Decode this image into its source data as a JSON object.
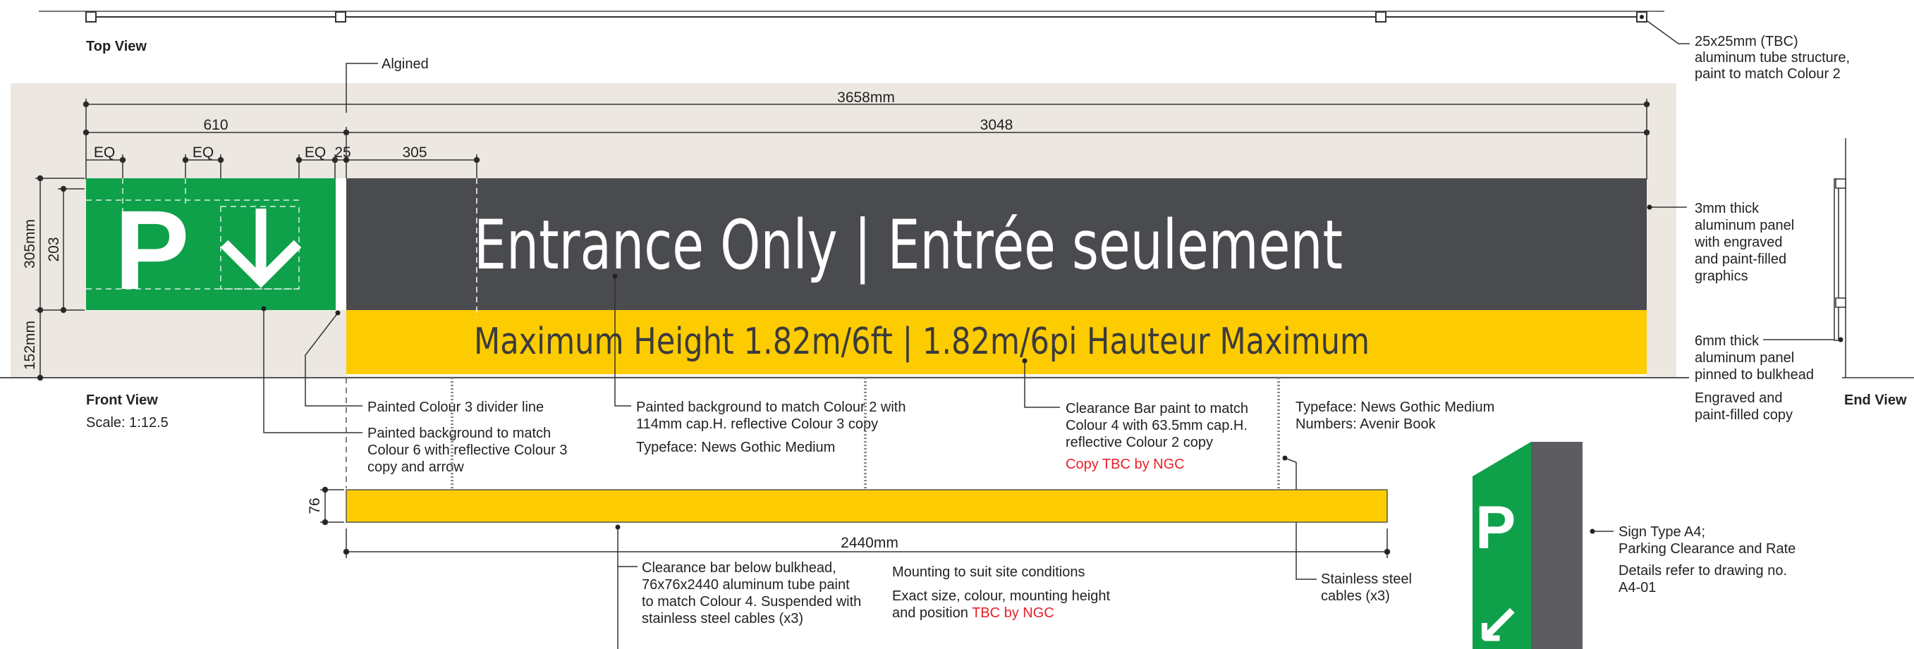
{
  "colors": {
    "background_wall": "#ece7e1",
    "panel_dark": "#4a4b4f",
    "panel_green": "#0fa04a",
    "panel_yellow": "#fdcc00",
    "line": "#222222",
    "accent_red": "#e8202a"
  },
  "icons": {
    "parking": "parking-p-icon",
    "arrow": "arrow-down-icon"
  },
  "top_view": {
    "label": "Top View",
    "tube_callout": [
      "25x25mm (TBC)",
      "aluminum tube structure,",
      "paint to match Colour 2"
    ]
  },
  "aligned_label": "Algined",
  "dimensions": {
    "overall": "3658mm",
    "left_panel": "610",
    "right_panel": "3048",
    "eq1": "EQ",
    "eq2": "EQ",
    "eq3": "EQ",
    "gap": "25",
    "indent": "305",
    "height_total": "305mm",
    "height_sign": "203",
    "height_bar": "152mm",
    "bar_height": "76",
    "bar_length": "2440mm"
  },
  "sign": {
    "parking_letter": "P",
    "main_text": "Entrance Only | Entrée seulement",
    "bar_text": "Maximum Height 1.82m/6ft  |  1.82m/6pi Hauteur Maximum"
  },
  "front_view": {
    "label": "Front View",
    "scale": "Scale: 1:12.5"
  },
  "callouts": {
    "divider": "Painted Colour 3 divider line",
    "green_bg": [
      "Painted background to match",
      "Colour 6 with reflective Colour 3",
      "copy and arrow"
    ],
    "dark_bg": [
      "Painted background to match Colour 2 with",
      "114mm cap.H. reflective Colour 3 copy"
    ],
    "dark_typeface": "Typeface: News Gothic Medium",
    "clearance_paint": [
      "Clearance Bar paint to match",
      "Colour 4 with 63.5mm cap.H.",
      "reflective Colour 2 copy"
    ],
    "copy_tbc": "Copy TBC by NGC",
    "typefaces": [
      "Typeface: News Gothic Medium",
      "Numbers: Avenir Book"
    ],
    "panel_3mm": [
      "3mm thick",
      "aluminum panel",
      "with engraved",
      "and paint-filled",
      "graphics"
    ],
    "panel_6mm": [
      "6mm thick",
      "aluminum panel",
      "pinned to bulkhead"
    ],
    "engraved": [
      "Engraved and",
      "paint-filled copy"
    ],
    "clearance_bar": [
      "Clearance bar below bulkhead,",
      "76x76x2440 aluminum tube paint",
      "to match Colour 4. Suspended with",
      "stainless steel cables (x3)"
    ],
    "mounting": "Mounting to suit site conditions",
    "exact": [
      "Exact size, colour, mounting height",
      "and position "
    ],
    "exact_tbc": "TBC by NGC",
    "cables": [
      "Stainless steel",
      "cables (x3)"
    ],
    "sign_type": [
      "Sign Type A4;",
      "Parking Clearance and Rate"
    ],
    "details": [
      "Details refer to drawing no.",
      "A4-01"
    ]
  },
  "end_view": {
    "label": "End View"
  },
  "thumbnail": {
    "letter": "P",
    "arrow": "↙"
  }
}
